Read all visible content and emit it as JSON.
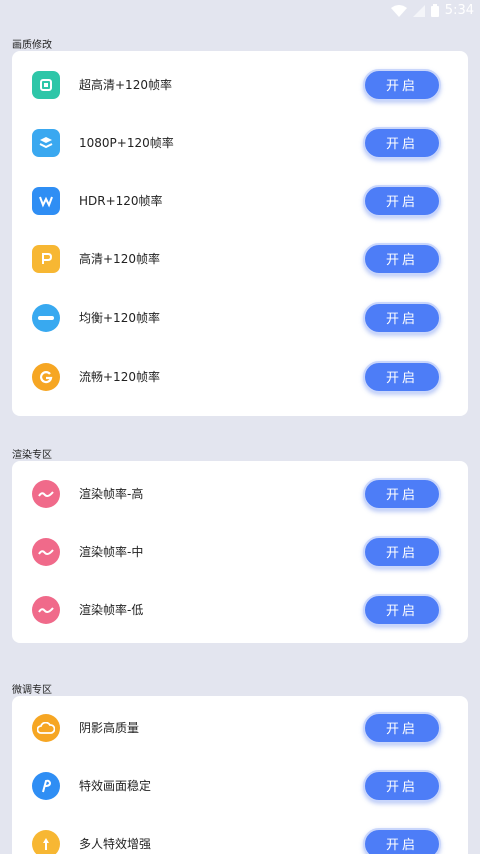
{
  "status_bar": {
    "time": "5:34"
  },
  "sections": [
    {
      "title": "画质修改",
      "items": [
        {
          "label": "超高清+120帧率",
          "button": "开启",
          "icon": "ultra-hd-icon",
          "color": "#2ec6a8"
        },
        {
          "label": "1080P+120帧率",
          "button": "开启",
          "icon": "layers-icon",
          "color": "#3aa8f0"
        },
        {
          "label": "HDR+120帧率",
          "button": "开启",
          "icon": "hdr-icon",
          "color": "#2f8ef4"
        },
        {
          "label": "高清+120帧率",
          "button": "开启",
          "icon": "hd-icon",
          "color": "#f7b733"
        },
        {
          "label": "均衡+120帧率",
          "button": "开启",
          "icon": "balance-cloud-icon",
          "color": "#38a9f0"
        },
        {
          "label": "流畅+120帧率",
          "button": "开启",
          "icon": "smooth-icon",
          "color": "#f6a623"
        }
      ]
    },
    {
      "title": "渲染专区",
      "items": [
        {
          "label": "渲染帧率-高",
          "button": "开启",
          "icon": "render-high-icon",
          "color": "#f06a8a"
        },
        {
          "label": "渲染帧率-中",
          "button": "开启",
          "icon": "render-mid-icon",
          "color": "#f06a8a"
        },
        {
          "label": "渲染帧率-低",
          "button": "开启",
          "icon": "render-low-icon",
          "color": "#f06a8a"
        }
      ]
    },
    {
      "title": "微调专区",
      "items": [
        {
          "label": "阴影高质量",
          "button": "开启",
          "icon": "shadow-cloud-icon",
          "color": "#f6a623"
        },
        {
          "label": "特效画面稳定",
          "button": "开启",
          "icon": "effect-stable-icon",
          "color": "#2f8ef4"
        },
        {
          "label": "多人特效增强",
          "button": "开启",
          "icon": "multi-effect-icon",
          "color": "#f7b733"
        }
      ]
    }
  ]
}
